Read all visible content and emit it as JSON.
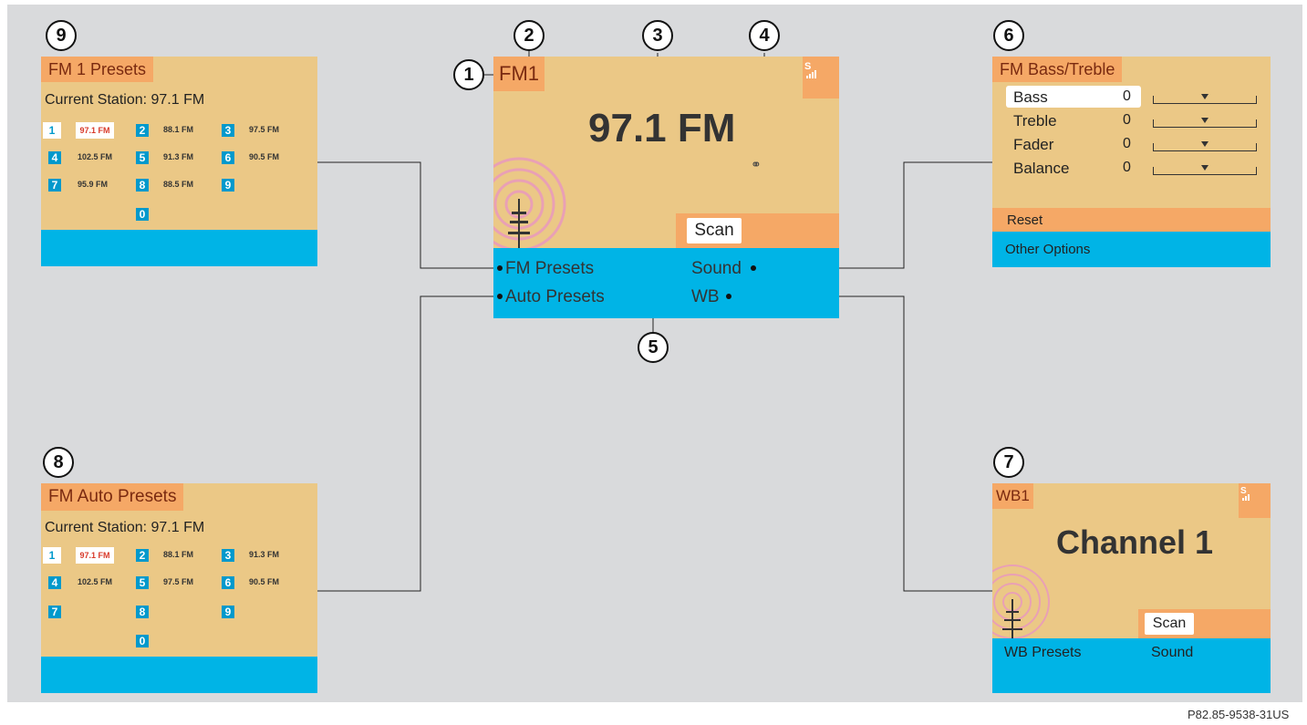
{
  "main": {
    "band": "FM1",
    "frequency": "97.1 FM",
    "scan": "Scan",
    "menu": {
      "fm_presets": "FM Presets",
      "sound": "Sound",
      "auto_presets": "Auto Presets",
      "wb": "WB"
    }
  },
  "callouts": [
    "1",
    "2",
    "3",
    "4",
    "5",
    "6",
    "7",
    "8",
    "9"
  ],
  "fm1_presets": {
    "title": "FM 1 Presets",
    "current": "Current Station: 97.1 FM",
    "presets": [
      {
        "n": "1",
        "v": "97.1 FM"
      },
      {
        "n": "2",
        "v": "88.1 FM"
      },
      {
        "n": "3",
        "v": "97.5 FM"
      },
      {
        "n": "4",
        "v": "102.5 FM"
      },
      {
        "n": "5",
        "v": "91.3 FM"
      },
      {
        "n": "6",
        "v": "90.5 FM"
      },
      {
        "n": "7",
        "v": "95.9 FM"
      },
      {
        "n": "8",
        "v": "88.5 FM"
      },
      {
        "n": "9",
        "v": ""
      },
      {
        "n": "0",
        "v": ""
      }
    ]
  },
  "fm_auto_presets": {
    "title": "FM Auto Presets",
    "current": "Current Station: 97.1 FM",
    "presets": [
      {
        "n": "1",
        "v": "97.1 FM"
      },
      {
        "n": "2",
        "v": "88.1 FM"
      },
      {
        "n": "3",
        "v": "91.3 FM"
      },
      {
        "n": "4",
        "v": "102.5 FM"
      },
      {
        "n": "5",
        "v": "97.5 FM"
      },
      {
        "n": "6",
        "v": "90.5 FM"
      },
      {
        "n": "7",
        "v": ""
      },
      {
        "n": "8",
        "v": ""
      },
      {
        "n": "9",
        "v": ""
      },
      {
        "n": "0",
        "v": ""
      }
    ]
  },
  "bass_treble": {
    "title": "FM Bass/Treble",
    "rows": [
      {
        "label": "Bass",
        "value": "0",
        "level": 0.5
      },
      {
        "label": "Treble",
        "value": "0",
        "level": 0.5
      },
      {
        "label": "Fader",
        "value": "0",
        "level": 0.5
      },
      {
        "label": "Balance",
        "value": "0",
        "level": 0.5
      }
    ],
    "reset": "Reset",
    "other": "Other Options"
  },
  "wb": {
    "band": "WB1",
    "channel": "Channel 1",
    "scan": "Scan",
    "menu": {
      "presets": "WB Presets",
      "sound": "Sound"
    }
  },
  "signal_letter": "S",
  "footer_code": "P82.85-9538-31US"
}
